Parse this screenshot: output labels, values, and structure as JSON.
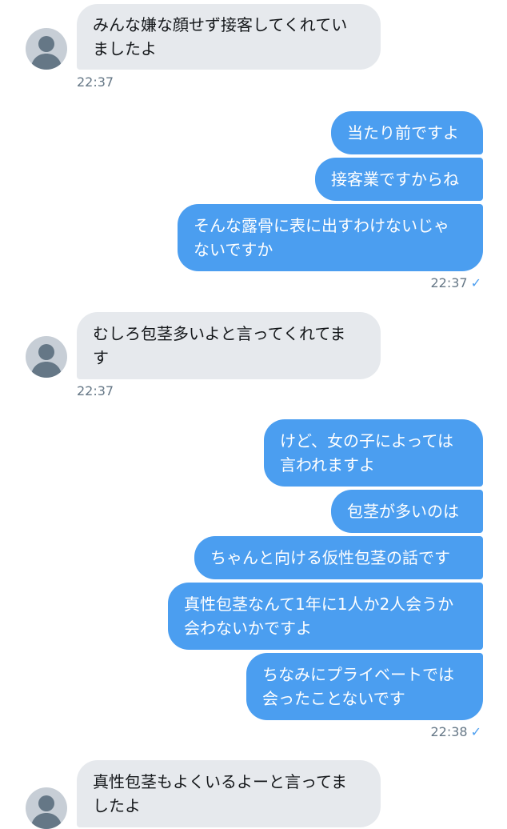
{
  "conversation": {
    "messages": [
      {
        "side": "incoming",
        "text": "みんな嫌な顔せず接客してくれてい\nましたよ"
      },
      {
        "side": "outgoing",
        "text": "当たり前ですよ"
      },
      {
        "side": "outgoing",
        "text": "接客業ですからね"
      },
      {
        "side": "outgoing",
        "text": "そんな露骨に表に出すわけないじゃ\nないですか"
      },
      {
        "side": "incoming",
        "text": "むしろ包茎多いよと言ってくれてま\nす"
      },
      {
        "side": "outgoing",
        "text": "けど、女の子によっては\n言われますよ"
      },
      {
        "side": "outgoing",
        "text": "包茎が多いのは"
      },
      {
        "side": "outgoing",
        "text": "ちゃんと向ける仮性包茎の話です"
      },
      {
        "side": "outgoing",
        "text": "真性包茎なんて1年に1人か2人会うか\n会わないかですよ"
      },
      {
        "side": "outgoing",
        "text": "ちなみにプライベートでは\n会ったことないです"
      },
      {
        "side": "incoming",
        "text": "真性包茎もよくいるよーと言ってま\nしたよ"
      }
    ],
    "timestamps": [
      {
        "time": "22:37",
        "read_mark": ""
      },
      {
        "time": "22:37",
        "read_mark": "✓"
      },
      {
        "time": "22:37",
        "read_mark": ""
      },
      {
        "time": "22:38",
        "read_mark": "✓"
      }
    ]
  },
  "colors": {
    "incoming_bubble": "#e6e9ed",
    "outgoing_bubble": "#4b9ef0",
    "timestamp": "#657786",
    "read_check": "#4b9ef0",
    "avatar_bg": "#c7ced6",
    "avatar_figure": "#657786"
  },
  "icons": {
    "avatar": "default-user-silhouette-icon",
    "read_mark": "check-icon"
  }
}
